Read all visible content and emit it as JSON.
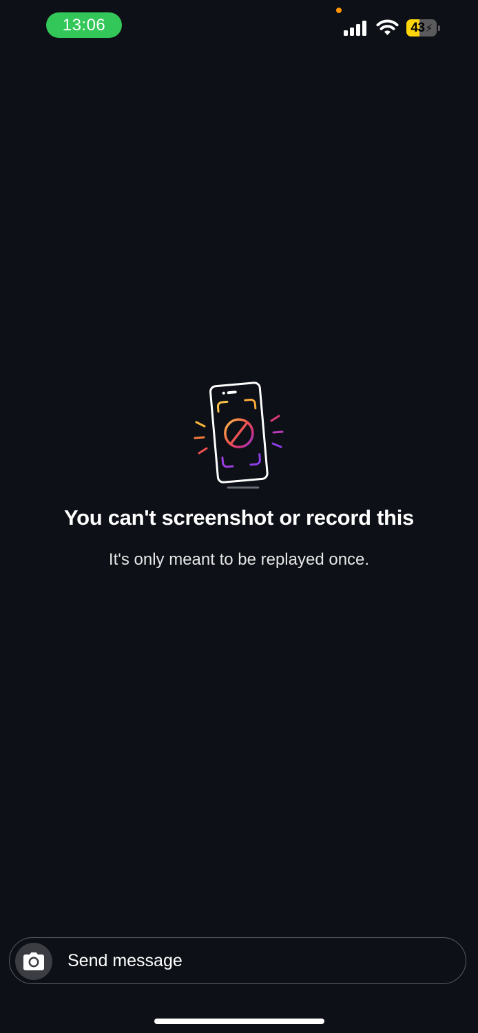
{
  "status_bar": {
    "time": "13:06",
    "battery_level": "43",
    "battery_fraction": 0.43,
    "battery_charging": true,
    "icons": [
      "signal-icon",
      "wifi-icon",
      "battery-icon",
      "privacy-dot"
    ],
    "time_pill_color": "#33c759",
    "battery_color": "#ffd60a"
  },
  "notice": {
    "icon": "screenshot-blocked-icon",
    "title": "You can't screenshot or record this",
    "subtitle": "It's only meant to be replayed once."
  },
  "composer": {
    "camera_icon": "camera-icon",
    "placeholder": "Send message"
  },
  "colors": {
    "background": "#0d1017",
    "text": "#ffffff"
  }
}
